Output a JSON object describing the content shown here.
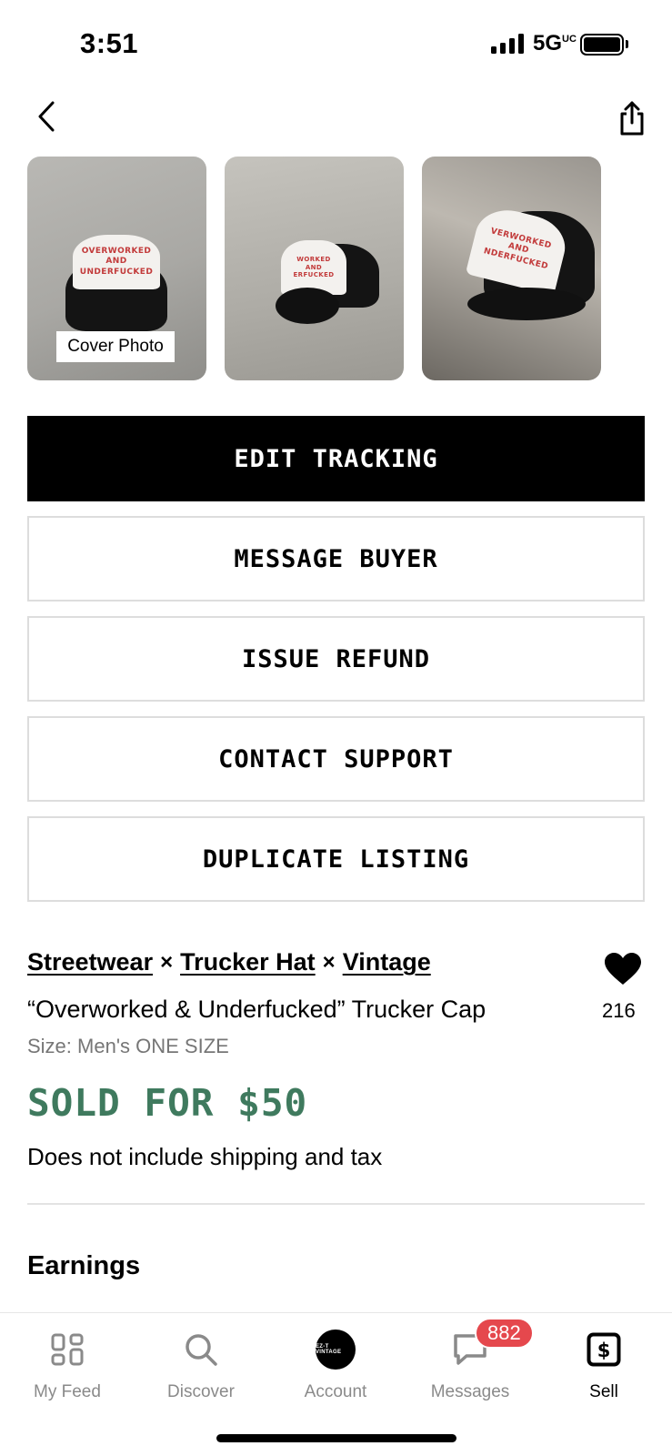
{
  "status_bar": {
    "time": "3:51",
    "network": "5G",
    "network_suffix": "UC"
  },
  "photos": {
    "cover_label": "Cover Photo",
    "hat_text": "OVERWORKED\nAND\nUNDERFUCKED"
  },
  "actions": {
    "edit_tracking": "EDIT TRACKING",
    "message_buyer": "MESSAGE BUYER",
    "issue_refund": "ISSUE REFUND",
    "contact_support": "CONTACT SUPPORT",
    "duplicate_listing": "DUPLICATE LISTING"
  },
  "listing": {
    "categories": [
      "Streetwear",
      "Trucker Hat",
      "Vintage"
    ],
    "separator": "×",
    "title": "“Overworked & Underfucked” Trucker Cap",
    "size": "Size: Men's ONE SIZE",
    "likes": "216",
    "sold_price": "SOLD FOR $50",
    "price_note": "Does not include shipping and tax"
  },
  "sections": {
    "earnings": "Earnings"
  },
  "tabbar": {
    "feed": "My Feed",
    "discover": "Discover",
    "account": "Account",
    "account_avatar_text": "EZ-T VINTAGE",
    "messages": "Messages",
    "messages_badge": "882",
    "sell": "Sell"
  },
  "colors": {
    "sold_green": "#3f7a5e",
    "badge_red": "#e5484d",
    "primary_button": "#000000"
  }
}
